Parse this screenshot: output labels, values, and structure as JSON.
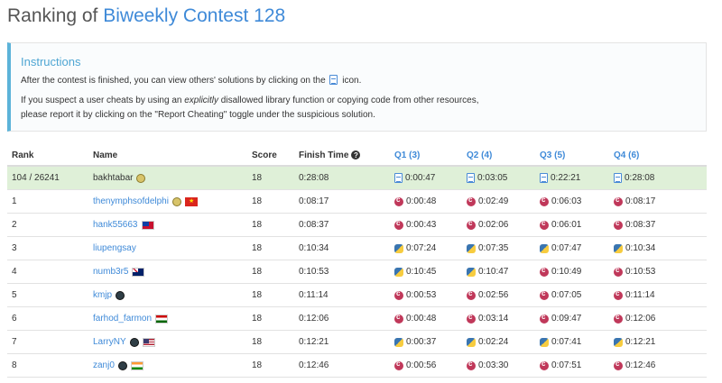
{
  "page": {
    "title_prefix": "Ranking of ",
    "contest_name": "Biweekly Contest 128"
  },
  "instructions": {
    "title": "Instructions",
    "line1_before": "After the contest is finished, you can view others' solutions by clicking on the",
    "line1_after": "icon.",
    "line2_before": "If you suspect a user cheats by using an",
    "line2_em": "explicitly",
    "line2_after": "disallowed library function or copying code from other resources,",
    "line3": "please report it by clicking on the \"Report Cheating\" toggle under the suspicious solution."
  },
  "table": {
    "headers": {
      "rank": "Rank",
      "name": "Name",
      "score": "Score",
      "finish_time": "Finish Time",
      "help_icon": "?",
      "q1": "Q1 (3)",
      "q2": "Q2 (4)",
      "q3": "Q3 (5)",
      "q4": "Q4 (6)"
    },
    "rows": [
      {
        "rank": "104 / 26241",
        "name": "bakhtabar",
        "badge": "guardian",
        "flag": "",
        "score": "18",
        "finish": "0:28:08",
        "is_me": true,
        "q": [
          {
            "lang": "doc",
            "time": "0:00:47"
          },
          {
            "lang": "doc",
            "time": "0:03:05"
          },
          {
            "lang": "doc",
            "time": "0:22:21"
          },
          {
            "lang": "doc",
            "time": "0:28:08"
          }
        ]
      },
      {
        "rank": "1",
        "name": "thenymphsofdelphi",
        "badge": "guardian",
        "flag": "vn",
        "score": "18",
        "finish": "0:08:17",
        "is_me": false,
        "q": [
          {
            "lang": "cpp",
            "time": "0:00:48"
          },
          {
            "lang": "cpp",
            "time": "0:02:49"
          },
          {
            "lang": "cpp",
            "time": "0:06:03"
          },
          {
            "lang": "cpp",
            "time": "0:08:17"
          }
        ]
      },
      {
        "rank": "2",
        "name": "hank55663",
        "badge": "",
        "flag": "tw",
        "score": "18",
        "finish": "0:08:37",
        "is_me": false,
        "q": [
          {
            "lang": "cpp",
            "time": "0:00:43"
          },
          {
            "lang": "cpp",
            "time": "0:02:06"
          },
          {
            "lang": "cpp",
            "time": "0:06:01"
          },
          {
            "lang": "cpp",
            "time": "0:08:37"
          }
        ]
      },
      {
        "rank": "3",
        "name": "liupengsay",
        "badge": "",
        "flag": "",
        "score": "18",
        "finish": "0:10:34",
        "is_me": false,
        "q": [
          {
            "lang": "py",
            "time": "0:07:24"
          },
          {
            "lang": "py",
            "time": "0:07:35"
          },
          {
            "lang": "py",
            "time": "0:07:47"
          },
          {
            "lang": "py",
            "time": "0:10:34"
          }
        ]
      },
      {
        "rank": "4",
        "name": "numb3r5",
        "badge": "",
        "flag": "au",
        "score": "18",
        "finish": "0:10:53",
        "is_me": false,
        "q": [
          {
            "lang": "py",
            "time": "0:10:45"
          },
          {
            "lang": "py",
            "time": "0:10:47"
          },
          {
            "lang": "cpp",
            "time": "0:10:49"
          },
          {
            "lang": "cpp",
            "time": "0:10:53"
          }
        ]
      },
      {
        "rank": "5",
        "name": "kmjp",
        "badge": "knight",
        "flag": "",
        "score": "18",
        "finish": "0:11:14",
        "is_me": false,
        "q": [
          {
            "lang": "cpp",
            "time": "0:00:53"
          },
          {
            "lang": "cpp",
            "time": "0:02:56"
          },
          {
            "lang": "cpp",
            "time": "0:07:05"
          },
          {
            "lang": "cpp",
            "time": "0:11:14"
          }
        ]
      },
      {
        "rank": "6",
        "name": "farhod_farmon",
        "badge": "",
        "flag": "tj",
        "score": "18",
        "finish": "0:12:06",
        "is_me": false,
        "q": [
          {
            "lang": "cpp",
            "time": "0:00:48"
          },
          {
            "lang": "cpp",
            "time": "0:03:14"
          },
          {
            "lang": "cpp",
            "time": "0:09:47"
          },
          {
            "lang": "cpp",
            "time": "0:12:06"
          }
        ]
      },
      {
        "rank": "7",
        "name": "LarryNY",
        "badge": "knight",
        "flag": "us",
        "score": "18",
        "finish": "0:12:21",
        "is_me": false,
        "q": [
          {
            "lang": "py",
            "time": "0:00:37"
          },
          {
            "lang": "py",
            "time": "0:02:24"
          },
          {
            "lang": "py",
            "time": "0:07:41"
          },
          {
            "lang": "py",
            "time": "0:12:21"
          }
        ]
      },
      {
        "rank": "8",
        "name": "zanj0",
        "badge": "knight",
        "flag": "in",
        "score": "18",
        "finish": "0:12:46",
        "is_me": false,
        "q": [
          {
            "lang": "cpp",
            "time": "0:00:56"
          },
          {
            "lang": "cpp",
            "time": "0:03:30"
          },
          {
            "lang": "cpp",
            "time": "0:07:51"
          },
          {
            "lang": "cpp",
            "time": "0:12:46"
          }
        ]
      }
    ]
  },
  "colors": {
    "link": "#3f8ad8",
    "highlight_row": "#dff0d8",
    "instructions_accent": "#5cb3d9"
  }
}
